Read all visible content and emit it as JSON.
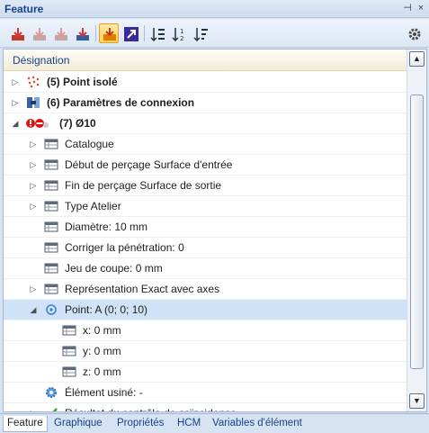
{
  "window": {
    "title": "Feature",
    "pin_glyph": "⊣",
    "close_glyph": "×"
  },
  "toolbar": {
    "buttons": [
      {
        "name": "feature-download-red-icon"
      },
      {
        "name": "feature-download-grey-icon"
      },
      {
        "name": "feature-download-grey2-icon"
      },
      {
        "name": "feature-download-blue-icon"
      },
      {
        "name": "feature-highlight-icon",
        "active": true
      },
      {
        "name": "arrow-purple-icon"
      },
      {
        "name": "sort-list-icon"
      },
      {
        "name": "sort-12-icon"
      },
      {
        "name": "sort-down-icon"
      }
    ],
    "settings_icon": "gear-icon"
  },
  "grid": {
    "column_header": "Désignation",
    "rows": [
      {
        "label": "(5) Point isolé",
        "bold": true,
        "expander": "▷",
        "icon": "dots-icon"
      },
      {
        "label": "(6) Paramètres de connexion",
        "bold": true,
        "expander": "▷",
        "icon": "connection-icon"
      },
      {
        "label": "(7)  Ø10",
        "bold": true,
        "expander": "◢",
        "icon": "drill-warning-icon"
      },
      {
        "label": "Catalogue",
        "expander": "▷",
        "icon": "table-icon"
      },
      {
        "label": "Début de perçage Surface d'entrée",
        "expander": "▷",
        "icon": "table-icon"
      },
      {
        "label": "Fin de perçage Surface de sortie",
        "expander": "▷",
        "icon": "table-icon"
      },
      {
        "label": "Type Atelier",
        "expander": "▷",
        "icon": "table-icon"
      },
      {
        "label": "Diamètre: 10 mm",
        "expander": "",
        "icon": "table-icon"
      },
      {
        "label": "Corriger la pénétration: 0",
        "expander": "",
        "icon": "table-icon"
      },
      {
        "label": "Jeu de coupe: 0 mm",
        "expander": "",
        "icon": "table-icon"
      },
      {
        "label": "Représentation  Exact avec axes",
        "expander": "▷",
        "icon": "table-icon"
      },
      {
        "label": "Point: A  (0; 0; 10)",
        "expander": "◢",
        "icon": "point-icon",
        "selected": true
      },
      {
        "label": "x: 0 mm",
        "expander": "",
        "icon": "table-icon"
      },
      {
        "label": "y: 0 mm",
        "expander": "",
        "icon": "table-icon"
      },
      {
        "label": "z: 0 mm",
        "expander": "",
        "icon": "table-icon"
      },
      {
        "label": "Élément usiné: -",
        "expander": "",
        "icon": "gear-blue-icon"
      },
      {
        "label": "Résultat du contrôle de coïncidence",
        "expander": "▷",
        "icon": "check-icon"
      }
    ]
  },
  "scrollbar": {
    "up": "▲",
    "down": "▼"
  },
  "tabs": [
    {
      "label": "Feature",
      "active": true
    },
    {
      "label": "Graphique"
    },
    {
      "label": "Propriétés"
    },
    {
      "label": "HCM"
    },
    {
      "label": "Variables d'élément"
    }
  ]
}
